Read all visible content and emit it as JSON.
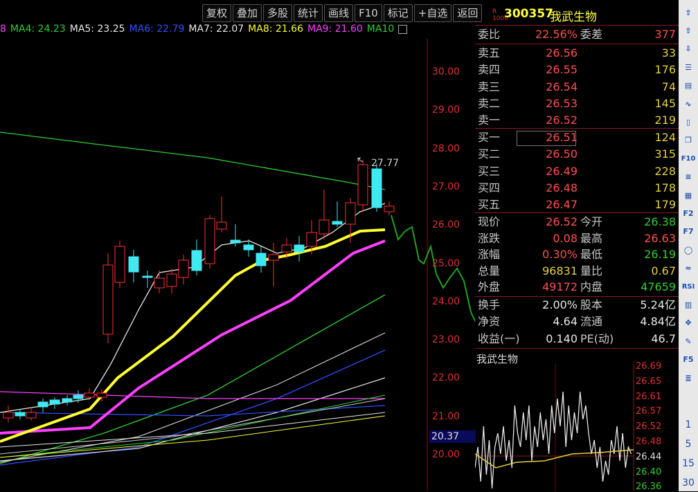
{
  "toolbar": [
    "复权",
    "叠加",
    "多股",
    "统计",
    "画线",
    "F10",
    "标记",
    "+自选",
    "返回"
  ],
  "ma_legend": [
    {
      "label": "8",
      "color": "#ff40ff"
    },
    {
      "label": "MA4: 24.23",
      "color": "#30d030"
    },
    {
      "label": "MA5: 23.25",
      "color": "#e8e8e8"
    },
    {
      "label": "MA6: 22.79",
      "color": "#3050ff"
    },
    {
      "label": "MA7: 22.07",
      "color": "#e8e8e8"
    },
    {
      "label": "MA8: 21.66",
      "color": "#ffff30"
    },
    {
      "label": "MA9: 21.60",
      "color": "#ff40ff"
    },
    {
      "label": "MA10",
      "color": "#30d030"
    }
  ],
  "y_axis": [
    "30.00",
    "29.00",
    "28.00",
    "27.00",
    "26.00",
    "25.00",
    "24.00",
    "23.00",
    "22.00",
    "21.00",
    "20.00"
  ],
  "high_marker": "27.77",
  "current_price_tag": "20.37",
  "quote": {
    "r_badge": "R",
    "r_badge2": "1000",
    "code": "300357",
    "name": "我武生物",
    "weibi_label": "委比",
    "weibi_value": "22.56%",
    "weicha_label": "委差",
    "weicha_value": "377",
    "asks": [
      {
        "label": "卖五",
        "price": "26.56",
        "vol": "33"
      },
      {
        "label": "卖四",
        "price": "26.55",
        "vol": "176"
      },
      {
        "label": "卖三",
        "price": "26.54",
        "vol": "74"
      },
      {
        "label": "卖二",
        "price": "26.53",
        "vol": "145"
      },
      {
        "label": "卖一",
        "price": "26.52",
        "vol": "219"
      }
    ],
    "bids": [
      {
        "label": "买一",
        "price": "26.51",
        "vol": "124"
      },
      {
        "label": "买二",
        "price": "26.50",
        "vol": "315"
      },
      {
        "label": "买三",
        "price": "26.49",
        "vol": "228"
      },
      {
        "label": "买四",
        "price": "26.48",
        "vol": "178"
      },
      {
        "label": "买五",
        "price": "26.47",
        "vol": "179"
      }
    ],
    "stats": [
      {
        "l1": "现价",
        "v1": "26.52",
        "c1": "red",
        "l2": "今开",
        "v2": "26.38",
        "c2": "green"
      },
      {
        "l1": "涨跌",
        "v1": "0.08",
        "c1": "red",
        "l2": "最高",
        "v2": "26.63",
        "c2": "red"
      },
      {
        "l1": "涨幅",
        "v1": "0.30%",
        "c1": "red",
        "l2": "最低",
        "v2": "26.19",
        "c2": "green"
      },
      {
        "l1": "总量",
        "v1": "96831",
        "c1": "yellow",
        "l2": "量比",
        "v2": "0.67",
        "c2": "yellow"
      },
      {
        "l1": "外盘",
        "v1": "49172",
        "c1": "red",
        "l2": "内盘",
        "v2": "47659",
        "c2": "green"
      }
    ],
    "stats2": [
      {
        "l1": "换手",
        "v1": "2.00%",
        "l2": "股本",
        "v2": "5.24亿"
      },
      {
        "l1": "净资",
        "v1": "4.64",
        "l2": "流通",
        "v2": "4.84亿"
      },
      {
        "l1": "收益(一)",
        "v1": "0.140",
        "l2": "PE(动)",
        "v2": "46.7"
      }
    ],
    "mini_title": "我武生物",
    "mini_ticks": [
      "26.69",
      "26.65",
      "26.61",
      "26.57",
      "26.52",
      "26.48",
      "26.44",
      "26.40",
      "26.36"
    ]
  },
  "sidebar": {
    "icons": [
      "arrow-up-icon",
      "arrow-up-outline-icon",
      "arrow-down-outline-icon",
      "list-icon",
      "table-icon",
      "line-chart-icon",
      "candle-chart-icon",
      "copy-icon",
      "f10-icon",
      "notes-icon",
      "grid-icon",
      "f2-icon",
      "f7-icon",
      "circle-icon",
      "wave-icon",
      "rsi-icon",
      "bars-icon",
      "move-icon",
      "pencil-icon",
      "f5-icon",
      "stack-icon"
    ],
    "numbers": [
      "1",
      "5",
      "15",
      "30"
    ]
  }
}
